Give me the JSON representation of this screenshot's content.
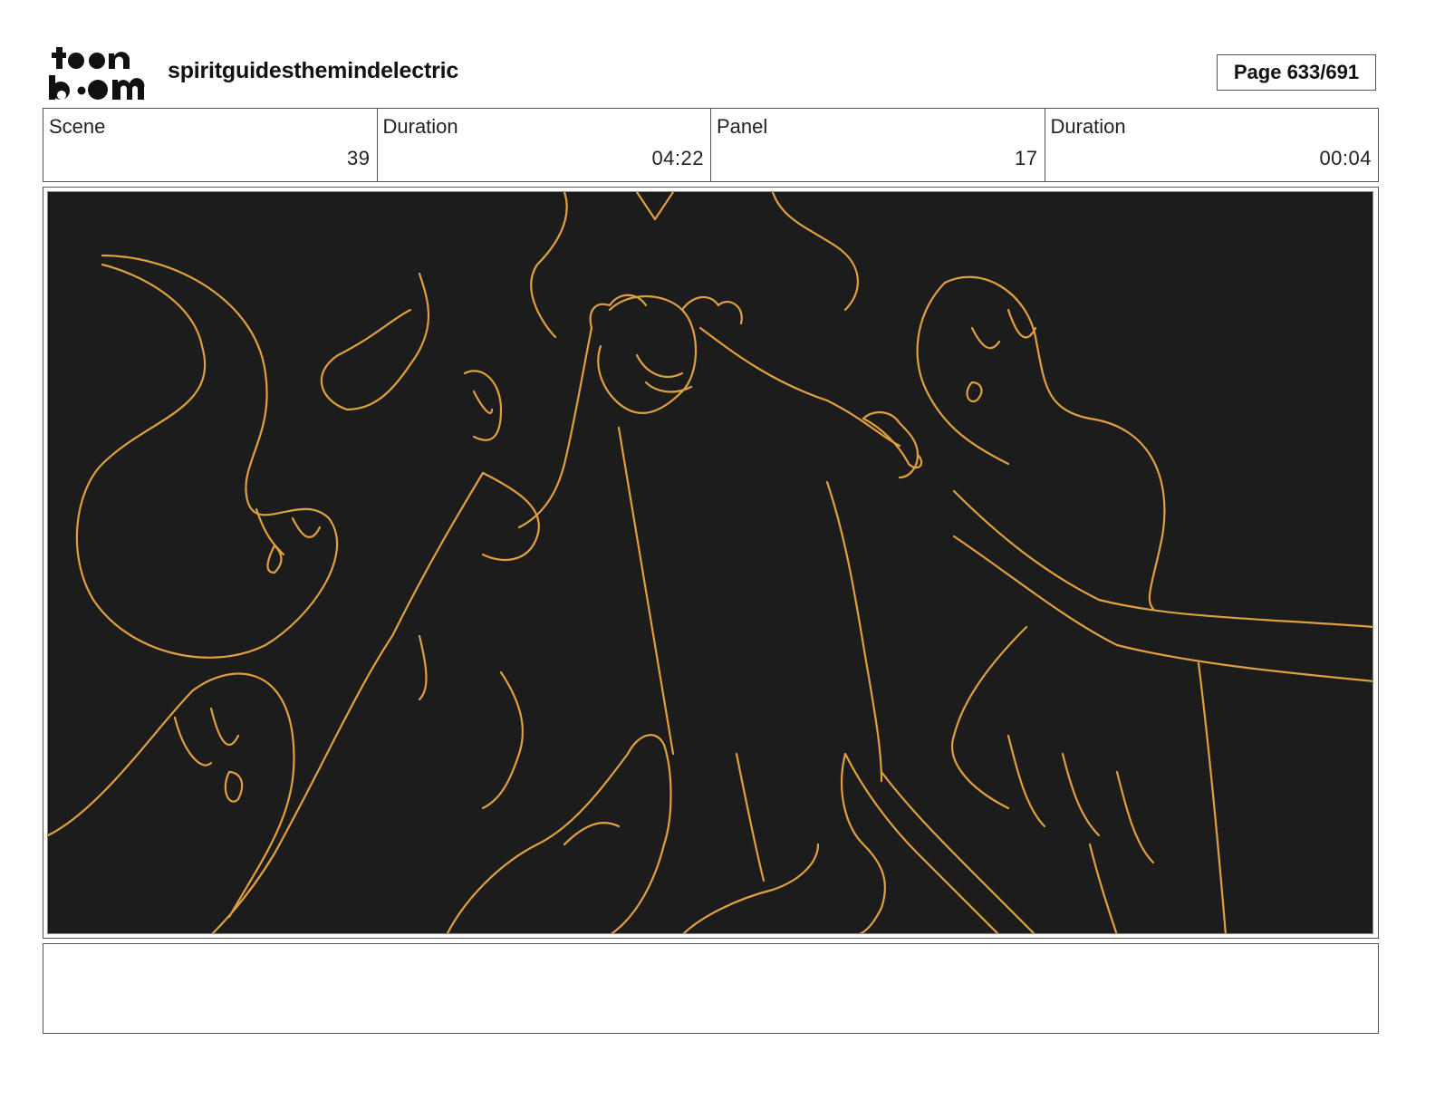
{
  "header": {
    "logo_line1": "toon",
    "logo_line2": "boom",
    "project_title": "spiritguidesthemindelectric",
    "page_label": "Page 633/691"
  },
  "info": {
    "scene_label": "Scene",
    "scene_value": "39",
    "scene_duration_label": "Duration",
    "scene_duration_value": "04:22",
    "panel_label": "Panel",
    "panel_value": "17",
    "panel_duration_label": "Duration",
    "panel_duration_value": "00:04"
  },
  "panel": {
    "background_color": "#1c1c1c",
    "line_color": "#e0a040"
  },
  "notes": {
    "text": ""
  }
}
